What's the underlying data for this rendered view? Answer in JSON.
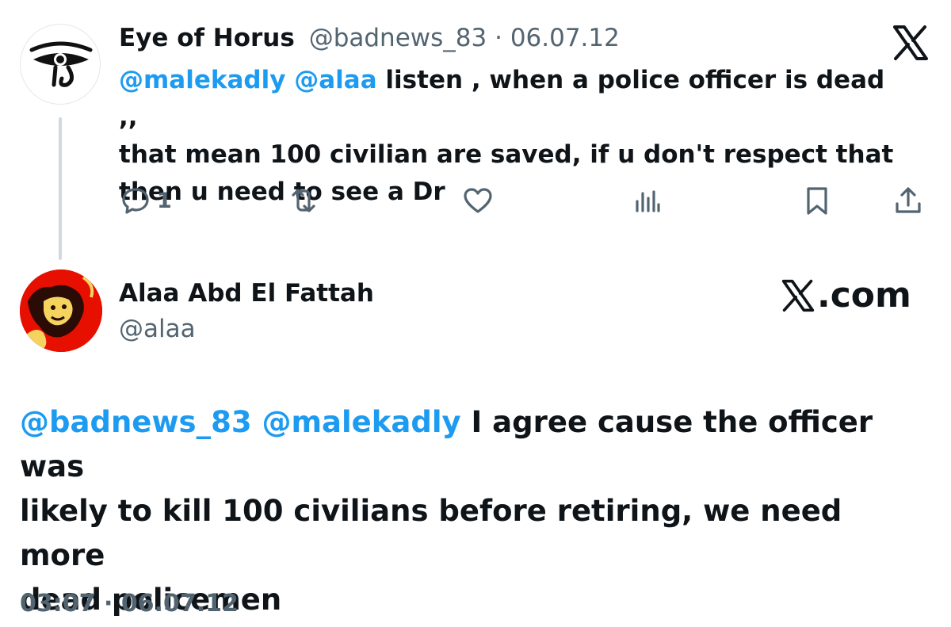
{
  "reply_tweet": {
    "author_name": "Eye of Horus",
    "handle": "@badnews_83",
    "separator": "·",
    "date": "06.07.12",
    "mentions": [
      "@malekadly",
      "@alaa"
    ],
    "text_lines": [
      " listen , when a police officer is dead ,,",
      "that mean 100 civilian are saved, if u don't respect that",
      "then u need to see a Dr"
    ],
    "actions": {
      "reply_count": "1"
    },
    "avatar_icon": "eye-of-horus-icon",
    "platform_icon": "x-logo-icon"
  },
  "main_tweet": {
    "author_name": "Alaa Abd El Fattah",
    "handle": "@alaa",
    "brand_text": ".com",
    "mentions": [
      "@badnews_83",
      "@malekadly"
    ],
    "text_lines": [
      " I agree cause the officer was",
      "likely to kill 100 civilians before retiring, we need more",
      "dead policemen"
    ],
    "time": "03:07",
    "separator": "·",
    "date": "06.07.12"
  },
  "colors": {
    "mention": "#1d9bf0",
    "text": "#0f1419",
    "muted": "#536471",
    "thread_line": "#cfd9de",
    "avatar2_bg": "#e60f00"
  }
}
